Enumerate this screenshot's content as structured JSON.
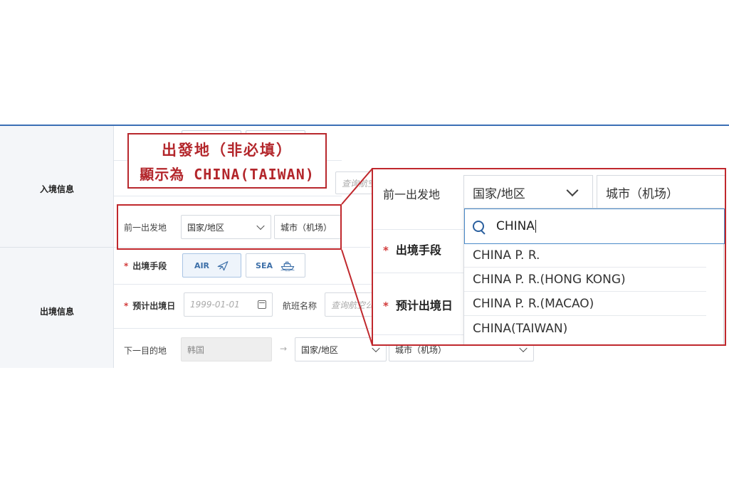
{
  "sections": {
    "entry_label": "入境信息",
    "exit_label": "出境信息"
  },
  "form": {
    "prev_origin": {
      "label": "前一出发地",
      "country_placeholder": "国家/地区",
      "city_placeholder": "城市（机场）"
    },
    "hidden_flight_search": "查询航空",
    "exit_method": {
      "label": "出境手段",
      "air": "AIR",
      "sea": "SEA"
    },
    "exit_date": {
      "label": "预计出境日",
      "placeholder": "1999-01-01"
    },
    "flight_name": {
      "label": "航班名称",
      "placeholder": "查询航空公"
    },
    "next_destination": {
      "label": "下一目的地",
      "value": "韩国",
      "country_placeholder": "国家/地区",
      "city_placeholder": "城市（机场）"
    }
  },
  "annotation": {
    "line1": "出發地（非必填）",
    "line2": "顯示為 CHINA(TAIWAN)"
  },
  "zoom": {
    "prev_origin_label": "前一出发地",
    "country_placeholder": "国家/地区",
    "city_placeholder": "城市（机场）",
    "exit_method_label": "出境手段",
    "exit_date_label": "预计出境日",
    "search_value": "CHINA",
    "options": [
      "CHINA P. R.",
      "CHINA P. R.(HONG KONG)",
      "CHINA P. R.(MACAO)",
      "CHINA(TAIWAN)"
    ]
  },
  "colors": {
    "accent_red": "#c0282d",
    "header_blue": "#3b6fb5",
    "button_text": "#3d6fa8"
  }
}
